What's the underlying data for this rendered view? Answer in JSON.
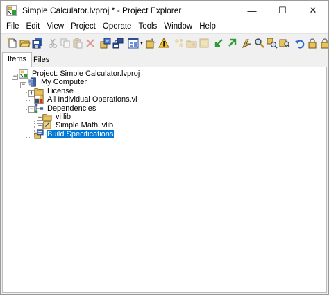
{
  "window": {
    "title": "Simple Calculator.lvproj * - Project Explorer",
    "controls": {
      "minimize": "—",
      "maximize": "☐",
      "close": "✕"
    }
  },
  "menu": [
    "File",
    "Edit",
    "View",
    "Project",
    "Operate",
    "Tools",
    "Window",
    "Help"
  ],
  "toolbar": {
    "buttons": [
      "new-item-icon",
      "open-icon",
      "save-all-icon",
      "cut-icon",
      "copy-icon",
      "paste-icon",
      "delete-icon",
      "build-icon",
      "deploy-icon",
      "view-icon",
      "properties-icon",
      "warning-icon",
      "add-files-icon",
      "add-folder-icon",
      "new-library-icon",
      "expand-all-icon",
      "collapse-all-icon",
      "run-icon",
      "search-icon",
      "zoom-icon",
      "find-icon",
      "undo-icon",
      "lock-icon",
      "lock2-icon"
    ]
  },
  "tabs": [
    {
      "label": "Items",
      "active": true
    },
    {
      "label": "Files",
      "active": false
    }
  ],
  "tree": {
    "project": "Project: Simple Calculator.lvproj",
    "my_computer": "My Computer",
    "license": "License",
    "operations_vi": "All Individual Operations.vi",
    "dependencies": "Dependencies",
    "vi_lib": "vi.lib",
    "simple_math": "Simple Math.lvlib",
    "build_specs": "Build Specifications"
  },
  "colors": {
    "selection": "#0078d7",
    "folder": "#e8c35a",
    "accent_green": "#2e9b3a"
  }
}
